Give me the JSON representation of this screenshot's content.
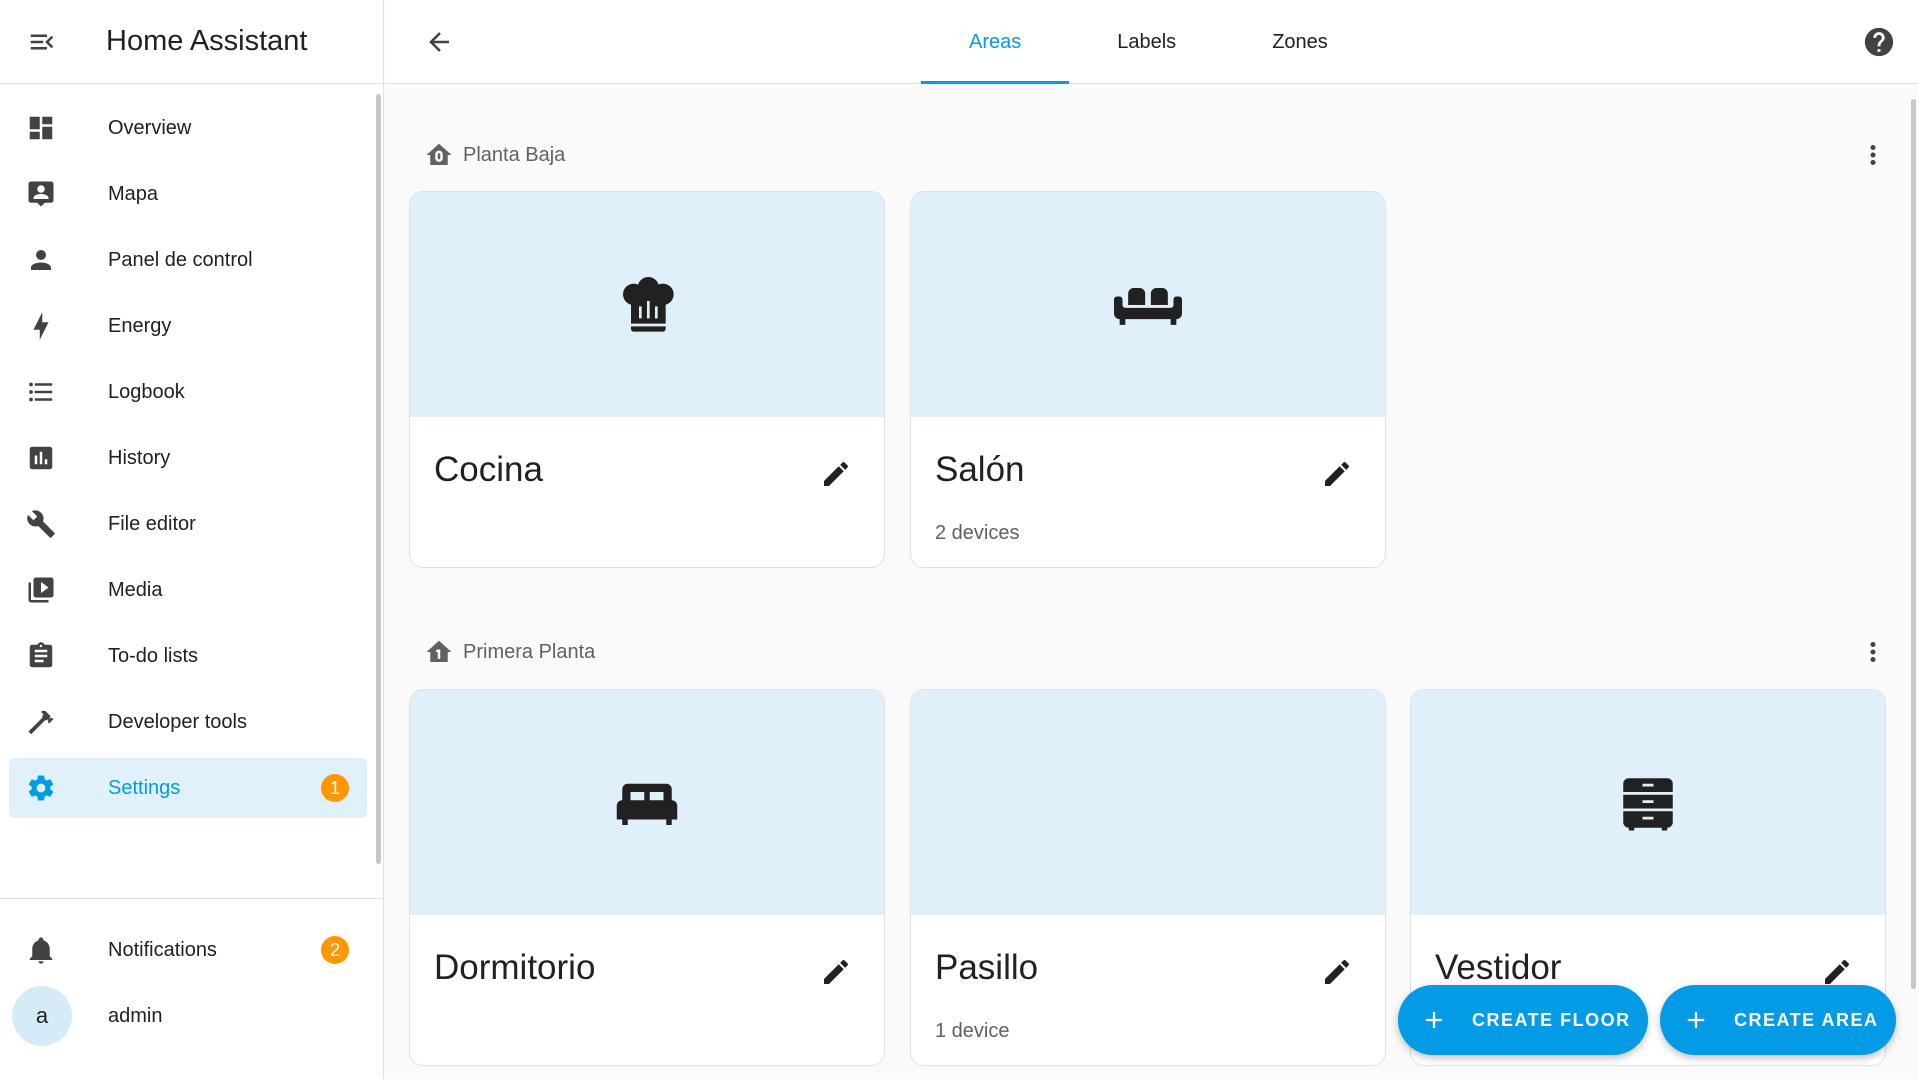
{
  "app": {
    "title": "Home Assistant"
  },
  "sidebar": {
    "items": [
      {
        "label": "Overview",
        "icon": "dashboard-icon"
      },
      {
        "label": "Mapa",
        "icon": "map-account-icon"
      },
      {
        "label": "Panel de control",
        "icon": "account-icon"
      },
      {
        "label": "Energy",
        "icon": "lightning-bolt-icon"
      },
      {
        "label": "Logbook",
        "icon": "list-icon"
      },
      {
        "label": "History",
        "icon": "chart-box-icon"
      },
      {
        "label": "File editor",
        "icon": "wrench-icon"
      },
      {
        "label": "Media",
        "icon": "play-box-icon"
      },
      {
        "label": "To-do lists",
        "icon": "clipboard-list-icon"
      },
      {
        "label": "Developer tools",
        "icon": "hammer-icon"
      },
      {
        "label": "Settings",
        "icon": "cog-icon",
        "badge": "1",
        "active": true
      }
    ],
    "notifications": {
      "label": "Notifications",
      "badge": "2"
    },
    "user": {
      "label": "admin",
      "initial": "a"
    }
  },
  "header": {
    "tabs": [
      {
        "label": "Areas",
        "active": true
      },
      {
        "label": "Labels"
      },
      {
        "label": "Zones"
      }
    ]
  },
  "floors": [
    {
      "name": "Planta Baja",
      "areas": [
        {
          "name": "Cocina",
          "devices": "",
          "icon": "chef-hat-icon"
        },
        {
          "name": "Salón",
          "devices": "2 devices",
          "icon": "sofa-icon"
        }
      ]
    },
    {
      "name": "Primera Planta",
      "areas": [
        {
          "name": "Dormitorio",
          "devices": "",
          "icon": "bed-icon"
        },
        {
          "name": "Pasillo",
          "devices": "1 device",
          "icon": ""
        },
        {
          "name": "Vestidor",
          "devices": "",
          "icon": "dresser-icon"
        }
      ]
    }
  ],
  "actions": {
    "create_floor": "CREATE FLOOR",
    "create_area": "CREATE AREA"
  },
  "colors": {
    "accent": "#039be5",
    "badge": "#ff9800",
    "card_image_bg": "#dff0fb",
    "active_bg": "#e1f1fb"
  }
}
